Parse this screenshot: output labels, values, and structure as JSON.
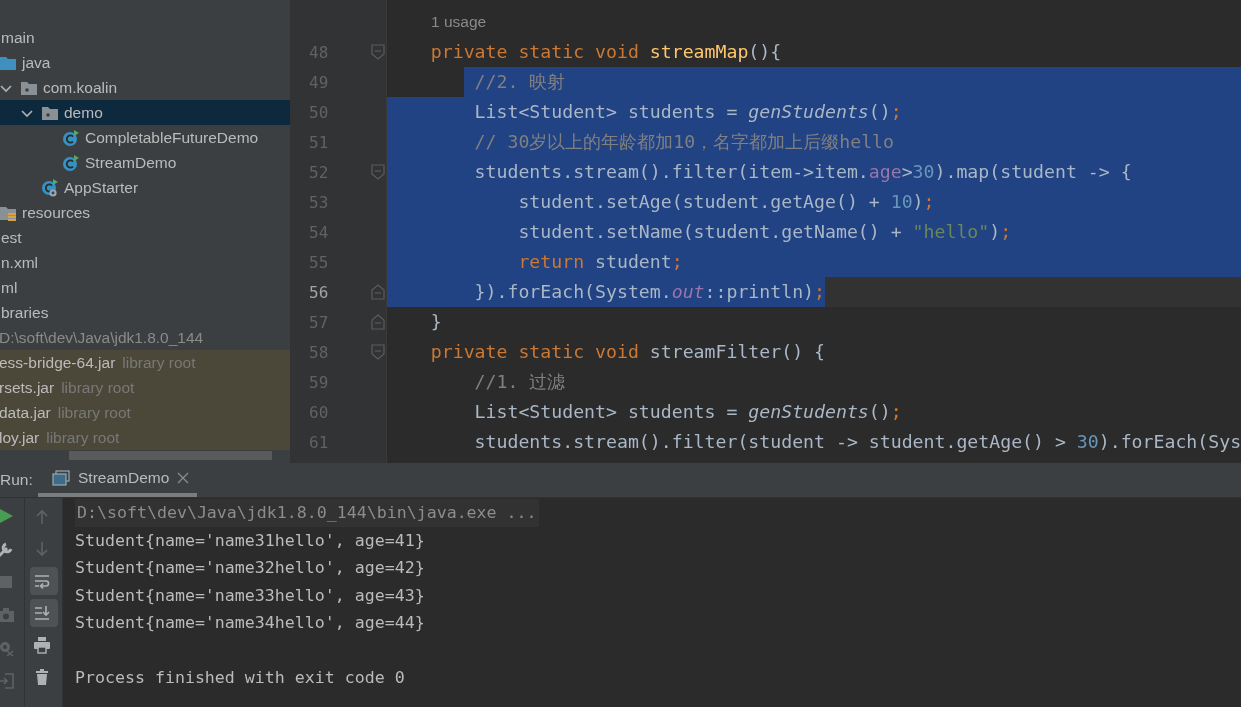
{
  "project_tree": {
    "items": [
      {
        "label": "main",
        "selected": false,
        "children": [
          {
            "label": "java",
            "kind": "source-folder",
            "selected": false,
            "children": [
              {
                "label": "com.koalin",
                "kind": "package",
                "selected": false,
                "expanded": true,
                "children": [
                  {
                    "label": "demo",
                    "kind": "package",
                    "selected": true,
                    "expanded": true,
                    "children": [
                      {
                        "label": "CompletableFutureDemo",
                        "kind": "class",
                        "selected": false
                      },
                      {
                        "label": "StreamDemo",
                        "kind": "class",
                        "selected": false
                      }
                    ]
                  },
                  {
                    "label": "AppStarter",
                    "kind": "app-class",
                    "selected": false
                  }
                ]
              }
            ]
          },
          {
            "label": "resources",
            "kind": "resources",
            "selected": false
          }
        ]
      },
      {
        "label": "est",
        "selected": false
      },
      {
        "label": "n.xml",
        "selected": false
      },
      {
        "label": "ml",
        "selected": false
      },
      {
        "label": "braries",
        "selected": false,
        "children": [
          {
            "label": "D:\\soft\\dev\\Java\\jdk1.8.0_144",
            "kind": "sdk",
            "selected": false
          },
          {
            "label": "ess-bridge-64.jar",
            "note": "library root",
            "kind": "jar",
            "selected": false
          },
          {
            "label": "rsets.jar",
            "note": "library root",
            "kind": "jar",
            "selected": false
          },
          {
            "label": "data.jar",
            "note": "library root",
            "kind": "jar",
            "selected": false
          },
          {
            "label": "loy.jar",
            "note": "library root",
            "kind": "jar",
            "selected": false
          }
        ]
      }
    ]
  },
  "editor": {
    "usage_hint": "1 usage",
    "lines": [
      {
        "number": "48",
        "kind": "fold-start",
        "selected": false,
        "current": false,
        "tokens": [
          {
            "t": "    private static void ",
            "kind": "keyword"
          },
          {
            "t": "streamMap",
            "kind": "method"
          },
          {
            "t": "(){",
            "kind": "plain"
          }
        ]
      },
      {
        "number": "49",
        "kind": "code",
        "selected": true,
        "current": false,
        "tokens": [
          {
            "t": "        //2. 映射",
            "kind": "comment"
          }
        ]
      },
      {
        "number": "50",
        "kind": "code",
        "selected": true,
        "current": false,
        "tokens": [
          {
            "t": "        List<Student> students = ",
            "kind": "plain"
          },
          {
            "t": "genStudents",
            "kind": "italic"
          },
          {
            "t": "()",
            "kind": "plain"
          },
          {
            "t": ";",
            "kind": "punct"
          }
        ]
      },
      {
        "number": "51",
        "kind": "code",
        "selected": true,
        "current": false,
        "tokens": [
          {
            "t": "        // 30岁以上的年龄都加10，名字都加上后缀hello",
            "kind": "comment"
          }
        ]
      },
      {
        "number": "52",
        "kind": "fold-start",
        "selected": true,
        "current": false,
        "tokens": [
          {
            "t": "        students.stream().filter(item->item.",
            "kind": "plain"
          },
          {
            "t": "age",
            "kind": "field"
          },
          {
            "t": ">",
            "kind": "plain"
          },
          {
            "t": "30",
            "kind": "number"
          },
          {
            "t": ").map(student -> {",
            "kind": "plain"
          }
        ]
      },
      {
        "number": "53",
        "kind": "code",
        "selected": true,
        "current": false,
        "tokens": [
          {
            "t": "            student.setAge(student.getAge() + ",
            "kind": "plain"
          },
          {
            "t": "10",
            "kind": "number"
          },
          {
            "t": ")",
            "kind": "plain"
          },
          {
            "t": ";",
            "kind": "punct"
          }
        ]
      },
      {
        "number": "54",
        "kind": "code",
        "selected": true,
        "current": false,
        "tokens": [
          {
            "t": "            student.setName(student.getName() + ",
            "kind": "plain"
          },
          {
            "t": "\"hello\"",
            "kind": "string"
          },
          {
            "t": ")",
            "kind": "plain"
          },
          {
            "t": ";",
            "kind": "punct"
          }
        ]
      },
      {
        "number": "55",
        "kind": "code",
        "selected": true,
        "current": false,
        "tokens": [
          {
            "t": "            return",
            "kind": "keyword"
          },
          {
            "t": " student",
            "kind": "plain"
          },
          {
            "t": ";",
            "kind": "punct"
          }
        ]
      },
      {
        "number": "56",
        "kind": "fold-end",
        "selected": true,
        "current": true,
        "tokens": [
          {
            "t": "        }).forEach(System.",
            "kind": "plain"
          },
          {
            "t": "out",
            "kind": "static"
          },
          {
            "t": "::println)",
            "kind": "plain"
          },
          {
            "t": ";",
            "kind": "punct"
          }
        ]
      },
      {
        "number": "57",
        "kind": "fold-end",
        "selected": false,
        "current": false,
        "tokens": [
          {
            "t": "    }",
            "kind": "plain"
          }
        ]
      },
      {
        "number": "58",
        "kind": "fold-start",
        "selected": false,
        "current": false,
        "tokens": [
          {
            "t": "    private static void ",
            "kind": "keyword"
          },
          {
            "t": "streamFilter() {",
            "kind": "plain"
          }
        ]
      },
      {
        "number": "59",
        "kind": "code",
        "selected": false,
        "current": false,
        "tokens": [
          {
            "t": "        //1. 过滤",
            "kind": "comment"
          }
        ]
      },
      {
        "number": "60",
        "kind": "code",
        "selected": false,
        "current": false,
        "tokens": [
          {
            "t": "        List<Student> students = ",
            "kind": "plain"
          },
          {
            "t": "genStudents",
            "kind": "italic"
          },
          {
            "t": "()",
            "kind": "plain"
          },
          {
            "t": ";",
            "kind": "punct"
          }
        ]
      },
      {
        "number": "61",
        "kind": "code",
        "selected": false,
        "current": false,
        "tokens": [
          {
            "t": "        students.stream().filter(student -> student.getAge() > ",
            "kind": "plain"
          },
          {
            "t": "30",
            "kind": "number"
          },
          {
            "t": ").forEach(Sys",
            "kind": "plain"
          }
        ]
      }
    ]
  },
  "run_panel": {
    "label": "Run:",
    "tabs": [
      {
        "label": "StreamDemo",
        "selected": true
      }
    ],
    "left_tools": [
      {
        "kind": "run",
        "disabled": false
      },
      {
        "kind": "wrench",
        "disabled": false
      },
      {
        "kind": "stop",
        "disabled": true
      },
      {
        "kind": "camera",
        "disabled": true
      },
      {
        "kind": "gear-bug",
        "disabled": true
      },
      {
        "kind": "exit",
        "disabled": true
      }
    ],
    "right_tools": [
      {
        "kind": "up",
        "disabled": true,
        "on": false
      },
      {
        "kind": "down",
        "disabled": true,
        "on": false
      },
      {
        "kind": "wrap",
        "disabled": false,
        "on": true
      },
      {
        "kind": "scroll-end",
        "disabled": false,
        "on": true
      },
      {
        "kind": "print",
        "disabled": false,
        "on": false
      },
      {
        "kind": "trash",
        "disabled": false,
        "on": false
      }
    ],
    "console": [
      {
        "kind": "command",
        "text": "D:\\soft\\dev\\Java\\jdk1.8.0_144\\bin\\java.exe ..."
      },
      {
        "kind": "output",
        "text": "Student{name='name31hello', age=41}"
      },
      {
        "kind": "output",
        "text": "Student{name='name32hello', age=42}"
      },
      {
        "kind": "output",
        "text": "Student{name='name33hello', age=43}"
      },
      {
        "kind": "output",
        "text": "Student{name='name34hello', age=44}"
      },
      {
        "kind": "exit",
        "text": "Process finished with exit code 0"
      }
    ]
  }
}
